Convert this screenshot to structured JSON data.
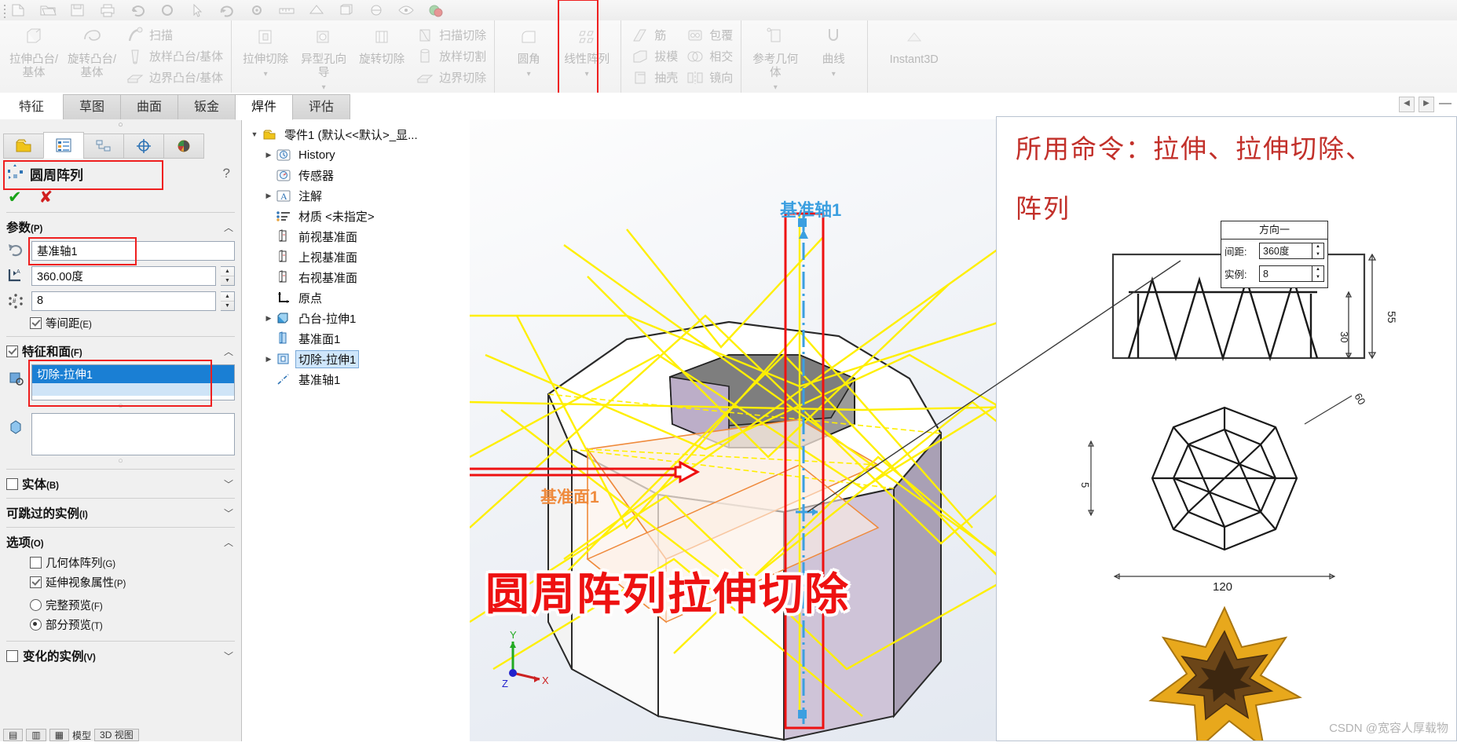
{
  "quick_access": {
    "icons": [
      "new-doc-icon",
      "open-icon",
      "save-icon",
      "print-icon",
      "undo-icon",
      "redo-icon",
      "select-icon",
      "rebuild-icon",
      "options-icon",
      "measure-icon",
      "section-view-icon",
      "view-orientation-icon",
      "display-style-icon",
      "hide-show-icon",
      "appearance-icon"
    ]
  },
  "ribbon": {
    "groups": [
      {
        "name": "features-boss",
        "big": [
          {
            "label": "拉伸凸台/基体",
            "icon": "extrude-boss-icon"
          },
          {
            "label": "旋转凸台/基体",
            "icon": "revolve-boss-icon"
          }
        ],
        "small": [
          {
            "label": "扫描",
            "icon": "sweep-icon"
          },
          {
            "label": "放样凸台/基体",
            "icon": "loft-boss-icon"
          },
          {
            "label": "边界凸台/基体",
            "icon": "boundary-boss-icon"
          }
        ]
      },
      {
        "name": "features-cut",
        "big": [
          {
            "label": "拉伸切除",
            "icon": "extrude-cut-icon",
            "has_dropdown": true
          },
          {
            "label": "异型孔向导",
            "icon": "hole-wizard-icon",
            "has_dropdown": true
          },
          {
            "label": "旋转切除",
            "icon": "revolve-cut-icon"
          }
        ],
        "small": [
          {
            "label": "扫描切除",
            "icon": "sweep-cut-icon"
          },
          {
            "label": "放样切割",
            "icon": "loft-cut-icon"
          },
          {
            "label": "边界切除",
            "icon": "boundary-cut-icon"
          }
        ]
      },
      {
        "name": "features-pattern",
        "big": [
          {
            "label": "圆角",
            "icon": "fillet-icon",
            "has_dropdown": true
          },
          {
            "label": "线性阵列",
            "icon": "linear-pattern-icon",
            "has_dropdown": true,
            "highlighted": true
          }
        ],
        "small": []
      },
      {
        "name": "features-misc",
        "big": [],
        "small": [
          {
            "label": "筋",
            "icon": "rib-icon"
          },
          {
            "label": "拔模",
            "icon": "draft-icon"
          },
          {
            "label": "抽壳",
            "icon": "shell-icon"
          }
        ],
        "small2": [
          {
            "label": "包覆",
            "icon": "wrap-icon"
          },
          {
            "label": "相交",
            "icon": "intersect-icon"
          },
          {
            "label": "镜向",
            "icon": "mirror-icon"
          }
        ]
      },
      {
        "name": "reference-geometry",
        "big": [
          {
            "label": "参考几何体",
            "icon": "reference-geometry-icon",
            "has_dropdown": true
          },
          {
            "label": "曲线",
            "icon": "curves-icon",
            "has_dropdown": true
          }
        ],
        "small": []
      },
      {
        "name": "instant3d",
        "big": [
          {
            "label": "Instant3D",
            "icon": "instant3d-icon"
          }
        ],
        "small": []
      }
    ]
  },
  "tabs": {
    "items": [
      {
        "label": "特征",
        "selected": false,
        "plain": true
      },
      {
        "label": "草图",
        "selected": false
      },
      {
        "label": "曲面",
        "selected": false
      },
      {
        "label": "钣金",
        "selected": false
      },
      {
        "label": "焊件",
        "selected": true
      },
      {
        "label": "评估",
        "selected": false
      }
    ],
    "right_controls": [
      "prev-icon",
      "next-icon",
      "minimize-icon"
    ]
  },
  "property_manager": {
    "tabs": [
      "feature-manager-tab",
      "property-manager-tab",
      "configuration-manager-tab",
      "dimxpert-manager-tab",
      "display-manager-tab"
    ],
    "selected_tab_index": 1,
    "title": "圆周阵列",
    "help_icon": "help-icon",
    "accept_label": "✔",
    "cancel_label": "✘",
    "sections": {
      "parameters": {
        "title": "参数",
        "hotkey": "(P)",
        "axis_icon": "rotation-axis-icon",
        "axis_value": "基准轴1",
        "angle_icon": "angle-icon",
        "angle_value": "360.00度",
        "count_icon": "instance-count-icon",
        "count_value": "8",
        "equal_spacing": {
          "label": "等间距",
          "hotkey": "(E)",
          "checked": true
        }
      },
      "features_faces": {
        "title": "特征和面",
        "hotkey": "(F)",
        "checked": true,
        "feature_icon": "feature-selection-icon",
        "selected_feature": "切除-拉伸1",
        "bodies_icon": "body-selection-icon",
        "bodies_value": ""
      },
      "bodies": {
        "title": "实体",
        "hotkey": "(B)",
        "checked": false
      },
      "skipped": {
        "title": "可跳过的实例",
        "hotkey": "(I)"
      },
      "options": {
        "title": "选项",
        "hotkey": "(O)",
        "items": [
          {
            "label": "几何体阵列",
            "hotkey": "(G)",
            "type": "checkbox",
            "checked": false
          },
          {
            "label": "延伸视象属性",
            "hotkey": "(P)",
            "type": "checkbox",
            "checked": true
          },
          {
            "label": "完整预览",
            "hotkey": "(F)",
            "type": "radio",
            "checked": false
          },
          {
            "label": "部分预览",
            "hotkey": "(T)",
            "type": "radio",
            "checked": true
          }
        ]
      },
      "variable": {
        "title": "变化的实例",
        "hotkey": "(V)",
        "checked": false
      }
    }
  },
  "bottom_bar": {
    "buttons": [
      "model-view-btn-1",
      "model-view-btn-2",
      "model-view-btn-3"
    ],
    "labels": [
      "模型",
      "3D 视图"
    ]
  },
  "feature_tree": {
    "nodes": [
      {
        "label": "零件1  (默认<<默认>_显...",
        "icon": "part-icon",
        "indent": 0,
        "arrow": "down"
      },
      {
        "label": "History",
        "icon": "history-icon",
        "indent": 1,
        "arrow": "right"
      },
      {
        "label": "传感器",
        "icon": "sensors-icon",
        "indent": 1,
        "arrow": ""
      },
      {
        "label": "注解",
        "icon": "annotations-icon",
        "indent": 1,
        "arrow": "right"
      },
      {
        "label": "材质 <未指定>",
        "icon": "material-icon",
        "indent": 1,
        "arrow": ""
      },
      {
        "label": "前视基准面",
        "icon": "plane-icon",
        "indent": 1,
        "arrow": ""
      },
      {
        "label": "上视基准面",
        "icon": "plane-icon",
        "indent": 1,
        "arrow": ""
      },
      {
        "label": "右视基准面",
        "icon": "plane-icon",
        "indent": 1,
        "arrow": ""
      },
      {
        "label": "原点",
        "icon": "origin-icon",
        "indent": 1,
        "arrow": ""
      },
      {
        "label": "凸台-拉伸1",
        "icon": "boss-extrude-icon",
        "indent": 1,
        "arrow": "right"
      },
      {
        "label": "基准面1",
        "icon": "plane-blue-icon",
        "indent": 1,
        "arrow": ""
      },
      {
        "label": "切除-拉伸1",
        "icon": "cut-extrude-icon",
        "indent": 1,
        "arrow": "right",
        "selected": true
      },
      {
        "label": "基准轴1",
        "icon": "axis-icon",
        "indent": 1,
        "arrow": ""
      }
    ]
  },
  "viewport": {
    "labels": [
      {
        "text": "基准轴1",
        "kind": "axis"
      },
      {
        "text": "基准面1",
        "kind": "plane"
      }
    ],
    "annotation_text": "圆周阵列拉伸切除",
    "axes_triad": [
      "X",
      "Y",
      "Z"
    ],
    "colors": {
      "accent_red": "#ee1111",
      "axis_blue": "#3b9fe0",
      "plane_orange": "#ef8a3c",
      "preview_yellow": "#ffef00",
      "face_purple": "#b9a8c4"
    }
  },
  "photo_panel": {
    "title_line1": "所用命令：拉伸、拉伸切除、",
    "title_line2": "阵列",
    "dialog": {
      "title": "方向一",
      "rows": [
        {
          "key": "间距:",
          "value": "360度"
        },
        {
          "key": "实例:",
          "value": "8"
        }
      ]
    },
    "drawing_dims": [
      "55",
      "30",
      "5",
      "60",
      "120"
    ],
    "watermark": "CSDN @宽容人厚载物"
  }
}
